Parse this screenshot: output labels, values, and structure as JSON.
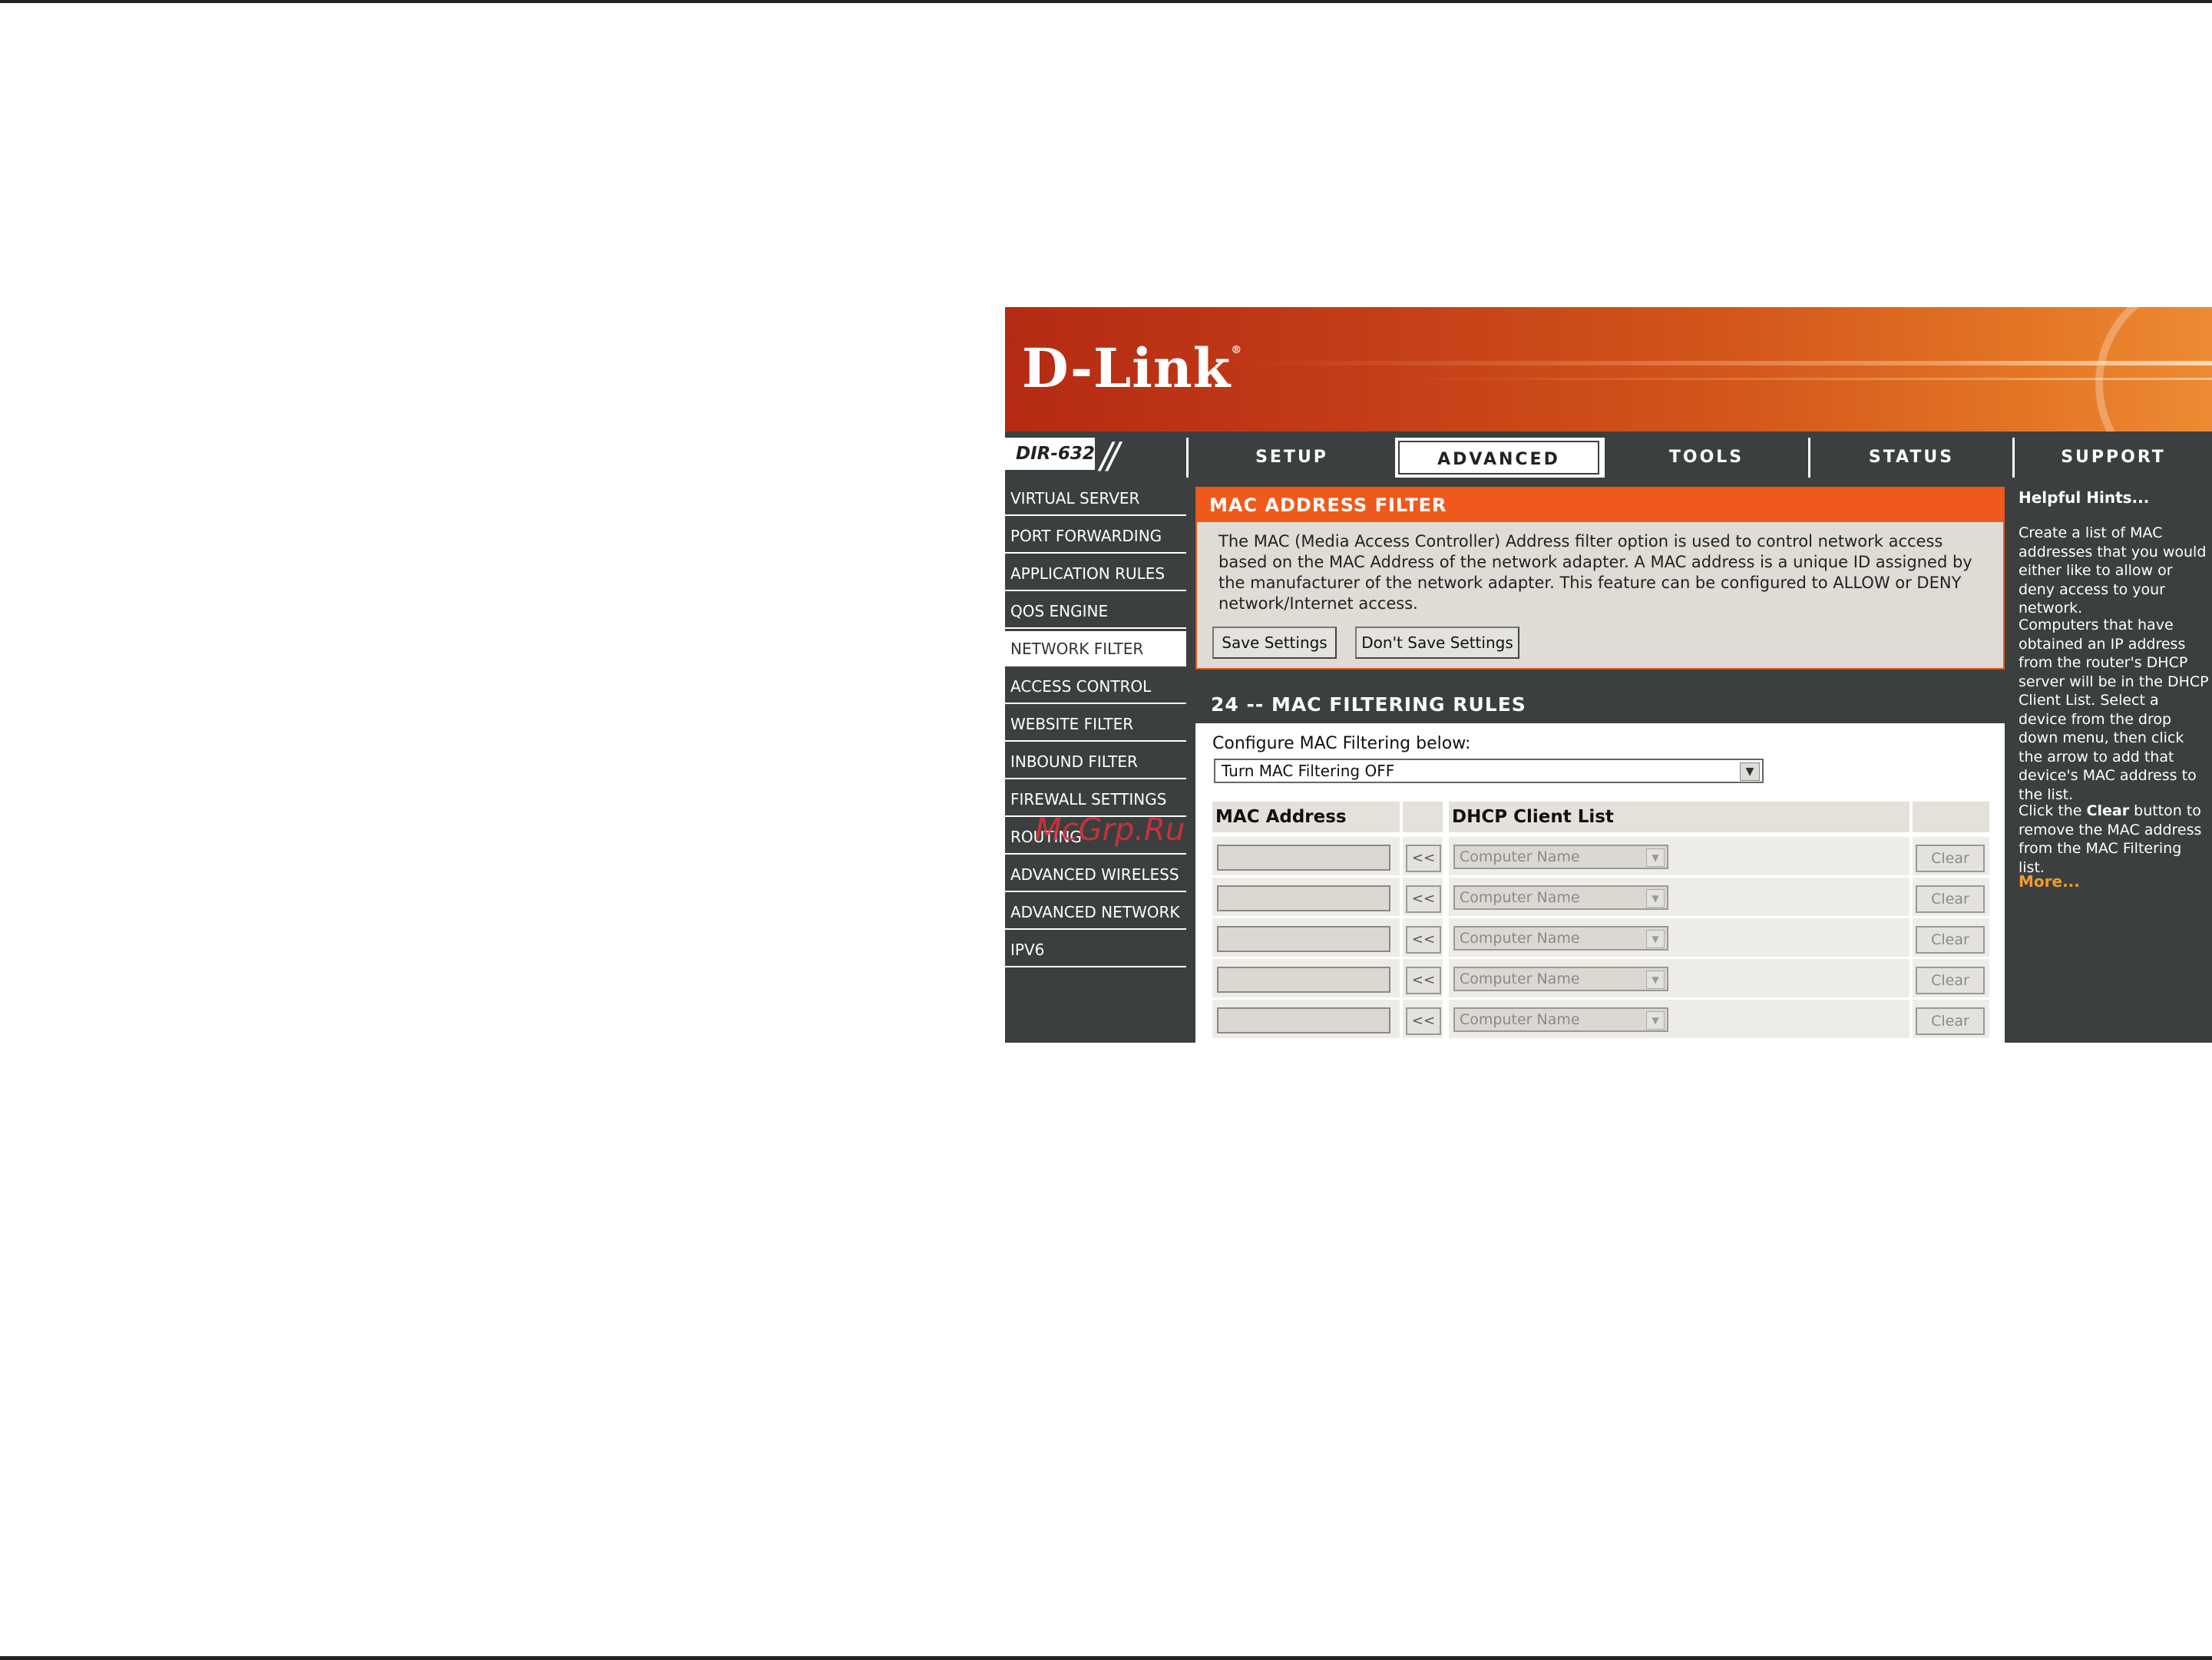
{
  "router": {
    "brand": "D-Link",
    "model": "DIR-632",
    "tabs": [
      {
        "label": "SETUP",
        "active": false
      },
      {
        "label": "ADVANCED",
        "active": true
      },
      {
        "label": "TOOLS",
        "active": false
      },
      {
        "label": "STATUS",
        "active": false
      },
      {
        "label": "SUPPORT",
        "active": false
      }
    ],
    "sidebar": [
      {
        "label": "VIRTUAL SERVER",
        "active": false
      },
      {
        "label": "PORT FORWARDING",
        "active": false
      },
      {
        "label": "APPLICATION RULES",
        "active": false
      },
      {
        "label": "QOS ENGINE",
        "active": false
      },
      {
        "label": "NETWORK FILTER",
        "active": true
      },
      {
        "label": "ACCESS CONTROL",
        "active": false
      },
      {
        "label": "WEBSITE FILTER",
        "active": false
      },
      {
        "label": "INBOUND FILTER",
        "active": false
      },
      {
        "label": "FIREWALL SETTINGS",
        "active": false
      },
      {
        "label": "ROUTING",
        "active": false
      },
      {
        "label": "ADVANCED WIRELESS",
        "active": false
      },
      {
        "label": "ADVANCED NETWORK",
        "active": false
      },
      {
        "label": "IPV6",
        "active": false
      }
    ],
    "mac_filter": {
      "title": "MAC ADDRESS FILTER",
      "description": "The MAC (Media Access Controller) Address filter option is used to control network access based on the MAC Address of the network adapter. A MAC address is a unique ID assigned by the manufacturer of the network adapter. This feature can be configured to ALLOW or DENY network/Internet access.",
      "save_label": "Save Settings",
      "dont_save_label": "Don't Save Settings"
    },
    "rules": {
      "title": "24 -- MAC FILTERING RULES",
      "configure_label": "Configure MAC Filtering below:",
      "mode_value": "Turn MAC Filtering OFF",
      "col_mac": "MAC Address",
      "col_dhcp": "DHCP Client List",
      "arrow_label": "<<",
      "computer_name_placeholder": "Computer Name",
      "clear_label": "Clear",
      "row_count": 5
    },
    "hints": {
      "title": "Helpful Hints...",
      "p1": "Create a list of MAC addresses that you would either like to allow or deny access to your network.",
      "p2": "Computers that have obtained an IP address from the router's DHCP server will be in the DHCP Client List. Select a device from the drop down menu, then click the arrow to add that device's MAC address to the list.",
      "p3_pre": "Click the ",
      "p3_bold": "Clear",
      "p3_post": " button to remove the MAC address from the MAC Filtering list.",
      "more": "More..."
    }
  },
  "watermark": "McGrp.Ru",
  "colors": {
    "orange": "#ef5a1c",
    "dark_gray": "#3b3f3f",
    "panel_beige": "#dfdcd6",
    "link_orange": "#f29b2c",
    "watermark_red": "#e0303a"
  }
}
